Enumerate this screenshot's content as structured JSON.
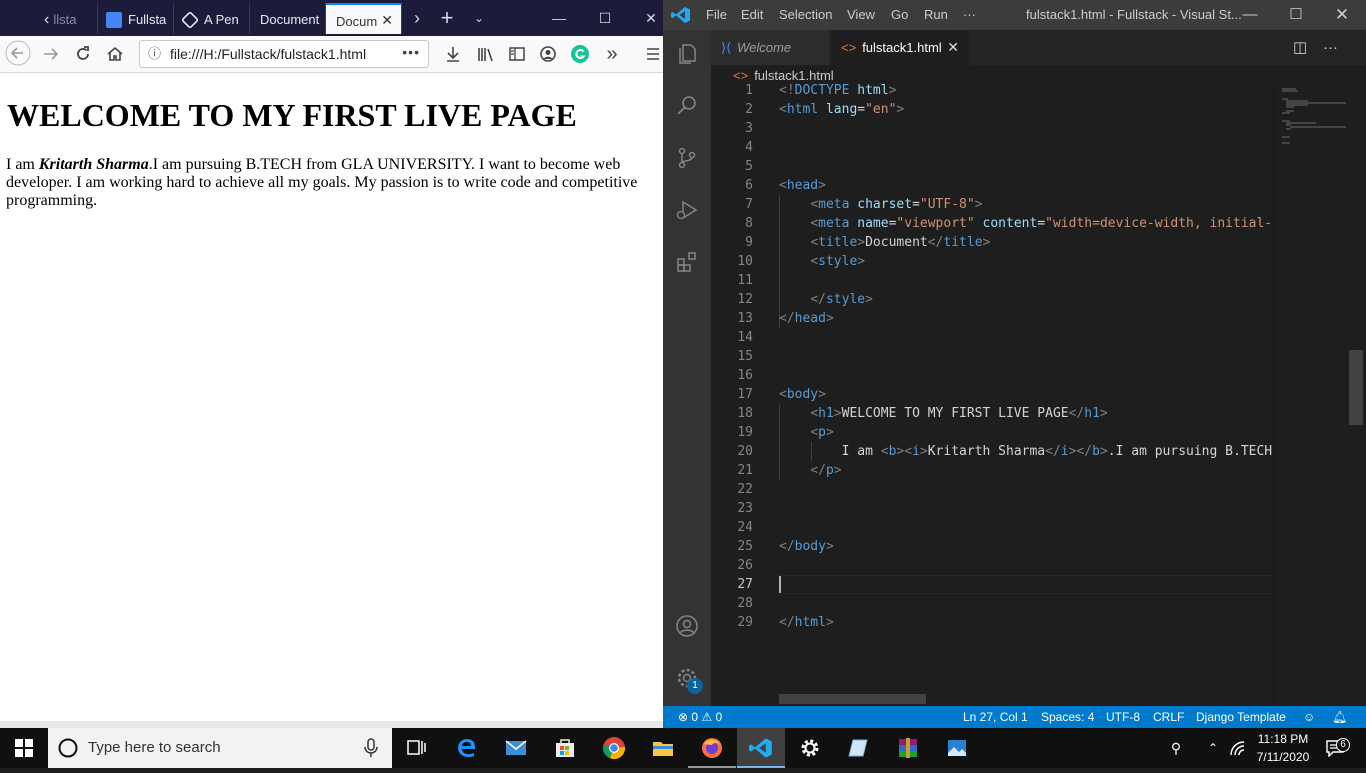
{
  "browser": {
    "tabs": [
      {
        "label": "llsta"
      },
      {
        "label": "Fullsta"
      },
      {
        "label": "A Pen"
      },
      {
        "label": "Document"
      },
      {
        "label": "Docum"
      }
    ],
    "url": "file:///H:/Fullstack/fulstack1.html",
    "page": {
      "h1": "WELCOME TO MY FIRST LIVE PAGE",
      "p_prefix": "I am ",
      "p_name": "Kritarth Sharma",
      "p_rest": ".I am pursuing B.TECH from GLA UNIVERSITY. I want to become web developer. I am working hard to achieve all my goals. My passion is to write code and competitive programming."
    }
  },
  "vscode": {
    "menu": [
      "File",
      "Edit",
      "Selection",
      "View",
      "Go",
      "Run",
      "···"
    ],
    "window_title": "fulstack1.html - Fullstack - Visual St...",
    "tabs": {
      "welcome": "Welcome",
      "file": "fulstack1.html"
    },
    "breadcrumb": "fulstack1.html",
    "status": {
      "problems": "0",
      "warnings": "0",
      "position": "Ln 27, Col 1",
      "spaces": "Spaces: 4",
      "encoding": "UTF-8",
      "eol": "CRLF",
      "language": "Django Template"
    },
    "accounts_badge": "1"
  },
  "taskbar": {
    "search_placeholder": "Type here to search",
    "time": "11:18 PM",
    "date": "7/11/2020",
    "notification_count": "6"
  },
  "colors": {
    "vscode_status": "#007acc",
    "firefox_tabbar": "#1c1b3a",
    "firefox_accent": "#0a84ff"
  }
}
